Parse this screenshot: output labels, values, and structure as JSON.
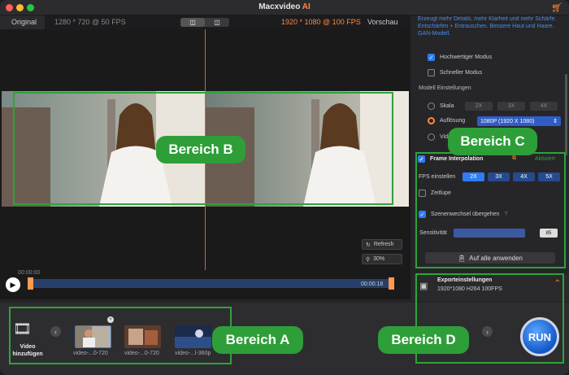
{
  "app": {
    "title_main": "Macxvideo ",
    "title_ai": "AI"
  },
  "preview": {
    "tab_original": "Original",
    "orig_info": "1280 * 720 @ 50 FPS",
    "out_info": "1920 * 1080 @ 100 FPS",
    "tab_preview": "Vorschau",
    "refresh_label": "Refresh",
    "zoom_label": "30%",
    "time_start": "00:00:00",
    "time_end": "00:00:18"
  },
  "settings": {
    "description": "Erzeugt mehr Details, mehr Klarheit und mehr Schärfe. Entschärfen + Entrauschen. Bessere Haut und Haare. GAN-Modell.",
    "high_quality": "Hochwertiger Modus",
    "fast_mode": "Schneller Modus",
    "model_settings": "Modell Einstellungen",
    "scale_label": "Skala",
    "scale_options": [
      "2X",
      "3X",
      "4X"
    ],
    "resolution_label": "Auflösung",
    "resolution_value": "1080P (1920 X 1080)",
    "vid_label": "Vid",
    "frame_interp": "Frame Interpolation",
    "activated": "Aktiviert",
    "fps_label": "FPS einstellen",
    "fps_options": [
      "2X",
      "3X",
      "4X",
      "5X"
    ],
    "slowmo": "Zeitlupe",
    "skip_scene": "Szenenwechsel übergehen",
    "help": "?",
    "sensitivity": "Sensitivität",
    "sensitivity_value": "85",
    "apply_all": "Auf alle anwenden"
  },
  "export": {
    "title": "Exporteinstellungen",
    "info": "1920*1080 H264 100FPS"
  },
  "bottom": {
    "add_video": "Video\nhinzufügen",
    "clips": [
      "video-...0-720",
      "video-...0-720",
      "video-...l-360p"
    ],
    "run": "RUN"
  },
  "annotations": {
    "a": "Bereich A",
    "b": "Bereich B",
    "c": "Bereich C",
    "d": "Bereich D"
  },
  "colors": {
    "accent": "#ff8a3d",
    "blue": "#2f7cf6",
    "annotation_green": "#2e9e38"
  }
}
